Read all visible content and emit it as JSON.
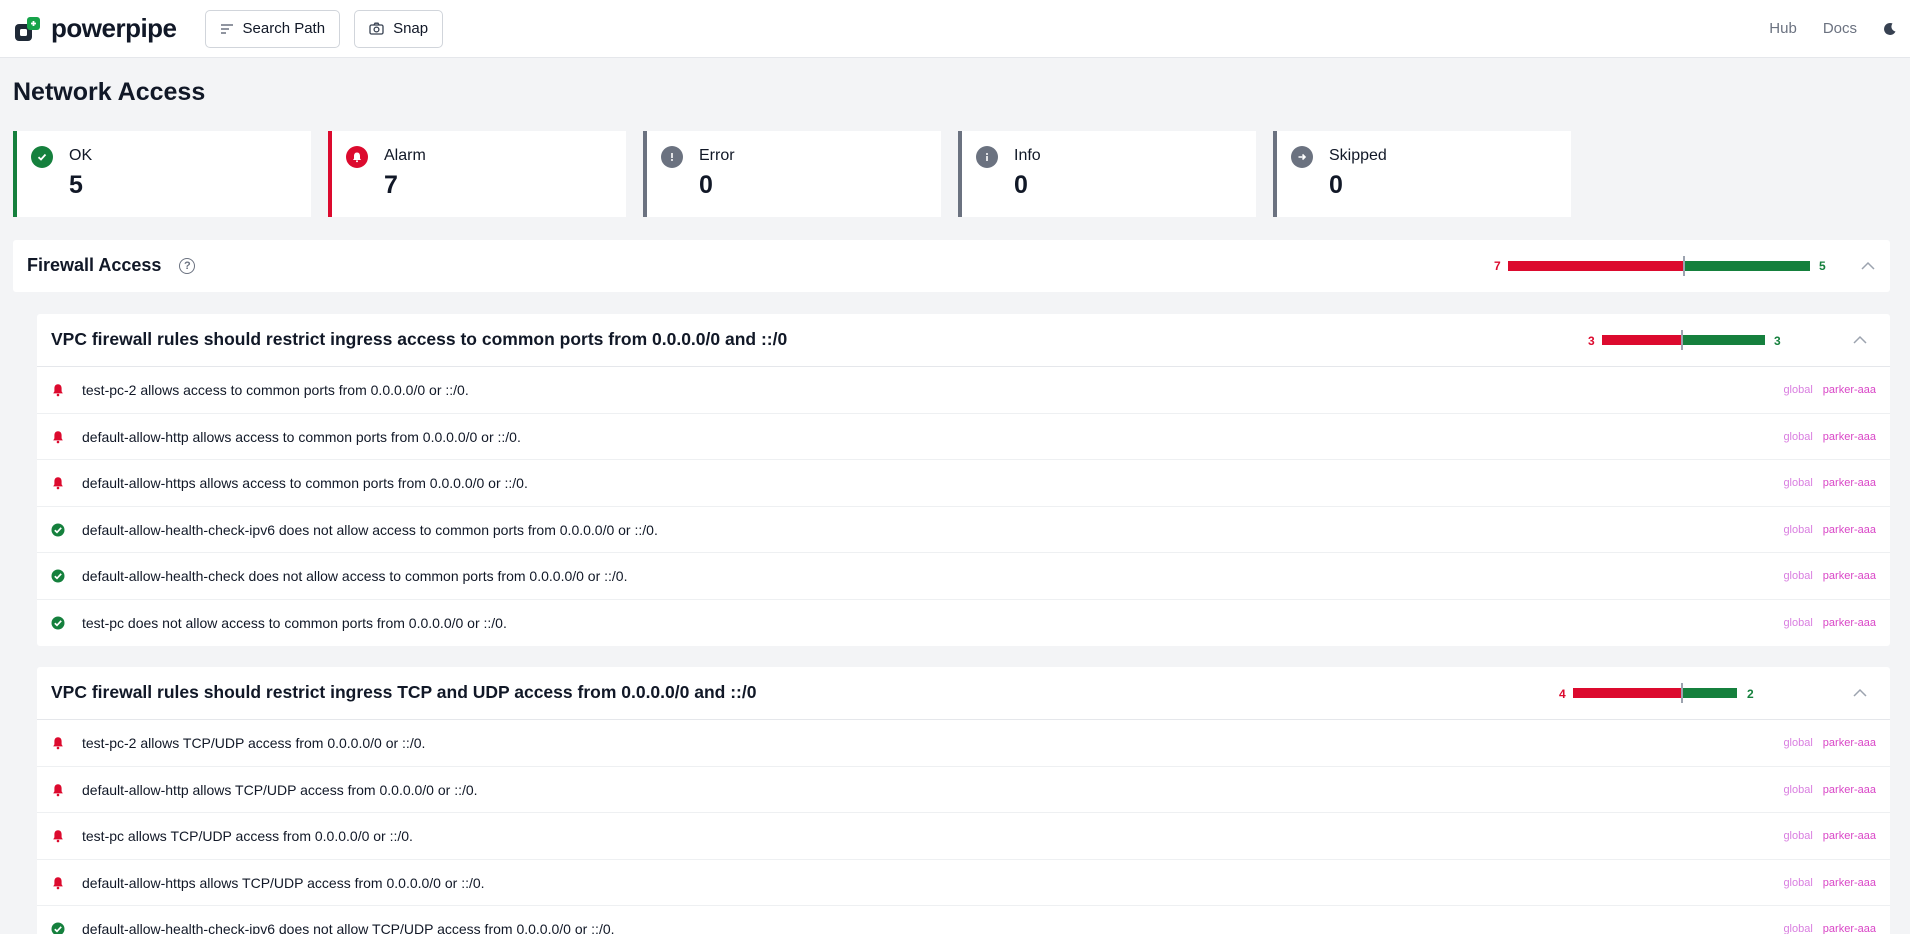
{
  "app": {
    "logo_text": "powerpipe",
    "search_path_label": "Search Path",
    "snap_label": "Snap",
    "hub_label": "Hub",
    "docs_label": "Docs"
  },
  "colors": {
    "ok": "#15803d",
    "alarm": "#dc0a2e",
    "neutral": "#6b7280",
    "tag_region": "#d97ee0",
    "tag_project": "#d946c7"
  },
  "page": {
    "title": "Network Access"
  },
  "summary": [
    {
      "label": "OK",
      "value": "5",
      "status": "ok",
      "icon": "check-circle-icon"
    },
    {
      "label": "Alarm",
      "value": "7",
      "status": "alarm",
      "icon": "bell-icon"
    },
    {
      "label": "Error",
      "value": "0",
      "status": "error",
      "icon": "exclamation-icon"
    },
    {
      "label": "Info",
      "value": "0",
      "status": "info",
      "icon": "info-icon"
    },
    {
      "label": "Skipped",
      "value": "0",
      "status": "skip",
      "icon": "arrow-right-icon"
    }
  ],
  "benchmark": {
    "title": "Firewall Access",
    "alarm_count": "7",
    "ok_count": "5"
  },
  "controls": [
    {
      "title": "VPC firewall rules should restrict ingress access to common ports from 0.0.0.0/0 and ::/0",
      "alarm_count": "3",
      "ok_count": "3",
      "rows": [
        {
          "status": "alarm",
          "text": "test-pc-2 allows access to common ports from 0.0.0.0/0 or ::/0.",
          "region": "global",
          "project": "parker-aaa"
        },
        {
          "status": "alarm",
          "text": "default-allow-http allows access to common ports from 0.0.0.0/0 or ::/0.",
          "region": "global",
          "project": "parker-aaa"
        },
        {
          "status": "alarm",
          "text": "default-allow-https allows access to common ports from 0.0.0.0/0 or ::/0.",
          "region": "global",
          "project": "parker-aaa"
        },
        {
          "status": "ok",
          "text": "default-allow-health-check-ipv6 does not allow access to common ports from 0.0.0.0/0 or ::/0.",
          "region": "global",
          "project": "parker-aaa"
        },
        {
          "status": "ok",
          "text": "default-allow-health-check does not allow access to common ports from 0.0.0.0/0 or ::/0.",
          "region": "global",
          "project": "parker-aaa"
        },
        {
          "status": "ok",
          "text": "test-pc does not allow access to common ports from 0.0.0.0/0 or ::/0.",
          "region": "global",
          "project": "parker-aaa"
        }
      ]
    },
    {
      "title": "VPC firewall rules should restrict ingress TCP and UDP access from 0.0.0.0/0 and ::/0",
      "alarm_count": "4",
      "ok_count": "2",
      "rows": [
        {
          "status": "alarm",
          "text": "test-pc-2 allows TCP/UDP access from 0.0.0.0/0 or ::/0.",
          "region": "global",
          "project": "parker-aaa"
        },
        {
          "status": "alarm",
          "text": "default-allow-http allows TCP/UDP access from 0.0.0.0/0 or ::/0.",
          "region": "global",
          "project": "parker-aaa"
        },
        {
          "status": "alarm",
          "text": "test-pc allows TCP/UDP access from 0.0.0.0/0 or ::/0.",
          "region": "global",
          "project": "parker-aaa"
        },
        {
          "status": "alarm",
          "text": "default-allow-https allows TCP/UDP access from 0.0.0.0/0 or ::/0.",
          "region": "global",
          "project": "parker-aaa"
        },
        {
          "status": "ok",
          "text": "default-allow-health-check-ipv6 does not allow TCP/UDP access from 0.0.0.0/0 or ::/0.",
          "region": "global",
          "project": "parker-aaa"
        }
      ]
    }
  ]
}
